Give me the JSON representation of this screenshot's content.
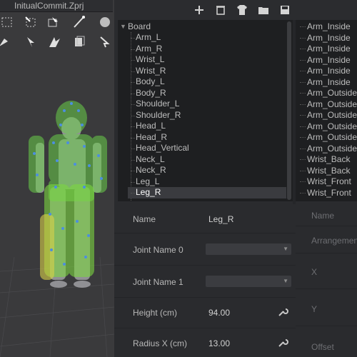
{
  "viewport": {
    "file_tab": "InitualCommit.Zprj"
  },
  "toolbar": {
    "buttons": [
      "add-icon",
      "trash-icon",
      "shirt-icon",
      "folder-icon",
      "save-icon"
    ]
  },
  "list": {
    "root": "Board",
    "items": [
      "Arm_L",
      "Arm_R",
      "Wrist_L",
      "Wrist_R",
      "Body_L",
      "Body_R",
      "Shoulder_L",
      "Shoulder_R",
      "Head_L",
      "Head_R",
      "Head_Vertical",
      "Neck_L",
      "Neck_R",
      "Leg_L",
      "Leg_R"
    ],
    "selected": "Leg_R"
  },
  "right_list": {
    "items": [
      "Arm_Inside",
      "Arm_Inside",
      "Arm_Inside",
      "Arm_Inside",
      "Arm_Inside",
      "Arm_Inside",
      "Arm_Outside",
      "Arm_Outside",
      "Arm_Outside",
      "Arm_Outside",
      "Arm_Outside",
      "Arm_Outside",
      "Wrist_Back",
      "Wrist_Back",
      "Wrist_Front",
      "Wrist_Front"
    ]
  },
  "properties": {
    "name_label": "Name",
    "name_value": "Leg_R",
    "joint0_label": "Joint Name 0",
    "joint1_label": "Joint Name 1",
    "height_label": "Height (cm)",
    "height_value": "94.00",
    "radius_label": "Radius X (cm)",
    "radius_value": "13.00"
  },
  "right_properties": {
    "name_label": "Name",
    "arrangement_label": "Arrangement",
    "x_label": "X",
    "y_label": "Y",
    "offset_label": "Offset"
  },
  "colors": {
    "accent_green": "#6ad04a",
    "accent_yellow": "#d8d04a"
  }
}
